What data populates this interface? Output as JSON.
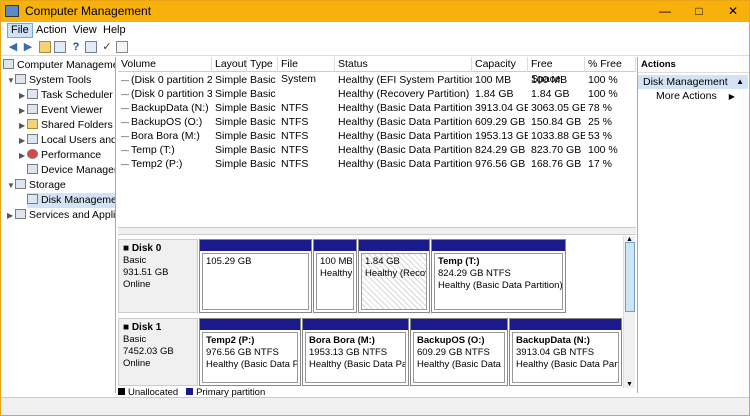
{
  "window": {
    "title": "Computer Management"
  },
  "menu": {
    "file": "File",
    "action": "Action",
    "view": "View",
    "help": "Help"
  },
  "tree": {
    "root": "Computer Management",
    "system_tools": "System Tools",
    "task_scheduler": "Task Scheduler",
    "event_viewer": "Event Viewer",
    "shared_folders": "Shared Folders",
    "local_users": "Local Users and",
    "performance": "Performance",
    "device_manager": "Device Manager",
    "storage": "Storage",
    "disk_management": "Disk Manageme",
    "services": "Services and Applic"
  },
  "grid": {
    "headers": [
      "Volume",
      "Layout",
      "Type",
      "File System",
      "Status",
      "Capacity",
      "Free Space",
      "% Free"
    ],
    "rows": [
      [
        "(Disk 0 partition 2)",
        "Simple",
        "Basic",
        "",
        "Healthy (EFI System Partition)",
        "100 MB",
        "100 MB",
        "100 %"
      ],
      [
        "(Disk 0 partition 3)",
        "Simple",
        "Basic",
        "",
        "Healthy (Recovery Partition)",
        "1.84 GB",
        "1.84 GB",
        "100 %"
      ],
      [
        "BackupData (N:)",
        "Simple",
        "Basic",
        "NTFS",
        "Healthy (Basic Data Partition)",
        "3913.04 GB",
        "3063.05 GB",
        "78 %"
      ],
      [
        "BackupOS (O:)",
        "Simple",
        "Basic",
        "NTFS",
        "Healthy (Basic Data Partition)",
        "609.29 GB",
        "150.84 GB",
        "25 %"
      ],
      [
        "Bora Bora (M:)",
        "Simple",
        "Basic",
        "NTFS",
        "Healthy (Basic Data Partition)",
        "1953.13 GB",
        "1033.88 GB",
        "53 %"
      ],
      [
        "Temp (T:)",
        "Simple",
        "Basic",
        "NTFS",
        "Healthy (Basic Data Partition)",
        "824.29 GB",
        "823.70 GB",
        "100 %"
      ],
      [
        "Temp2 (P:)",
        "Simple",
        "Basic",
        "NTFS",
        "Healthy (Basic Data Partition)",
        "976.56 GB",
        "168.76 GB",
        "17 %"
      ]
    ]
  },
  "disks": [
    {
      "name": "Disk 0",
      "type": "Basic",
      "size": "931.51 GB",
      "state": "Online",
      "partitions": [
        {
          "name": "",
          "size": "105.29 GB",
          "status": ""
        },
        {
          "name": "",
          "size": "100 MB",
          "status": "Healthy ("
        },
        {
          "name": "",
          "size": "1.84 GB",
          "status": "Healthy (Recove"
        },
        {
          "name": "Temp  (T:)",
          "size": "824.29 GB NTFS",
          "status": "Healthy (Basic Data Partition)"
        }
      ]
    },
    {
      "name": "Disk 1",
      "type": "Basic",
      "size": "7452.03 GB",
      "state": "Online",
      "partitions": [
        {
          "name": "Temp2  (P:)",
          "size": "976.56 GB NTFS",
          "status": "Healthy (Basic Data Par"
        },
        {
          "name": "Bora Bora  (M:)",
          "size": "1953.13 GB NTFS",
          "status": "Healthy (Basic Data Part"
        },
        {
          "name": "BackupOS  (O:)",
          "size": "609.29 GB NTFS",
          "status": "Healthy (Basic Data Part"
        },
        {
          "name": "BackupData  (N:)",
          "size": "3913.04 GB NTFS",
          "status": "Healthy (Basic Data Parti"
        }
      ]
    }
  ],
  "legend": {
    "unallocated": "Unallocated",
    "primary": "Primary partition",
    "unallocated_color": "#000000",
    "primary_color": "#1a1a8c"
  },
  "actions": {
    "header": "Actions",
    "selected": "Disk Management",
    "more": "More Actions"
  },
  "colors": {
    "titlebar": "#f7b10a",
    "partition_bar": "#1a1a8c",
    "selection": "#d3e3f5"
  }
}
